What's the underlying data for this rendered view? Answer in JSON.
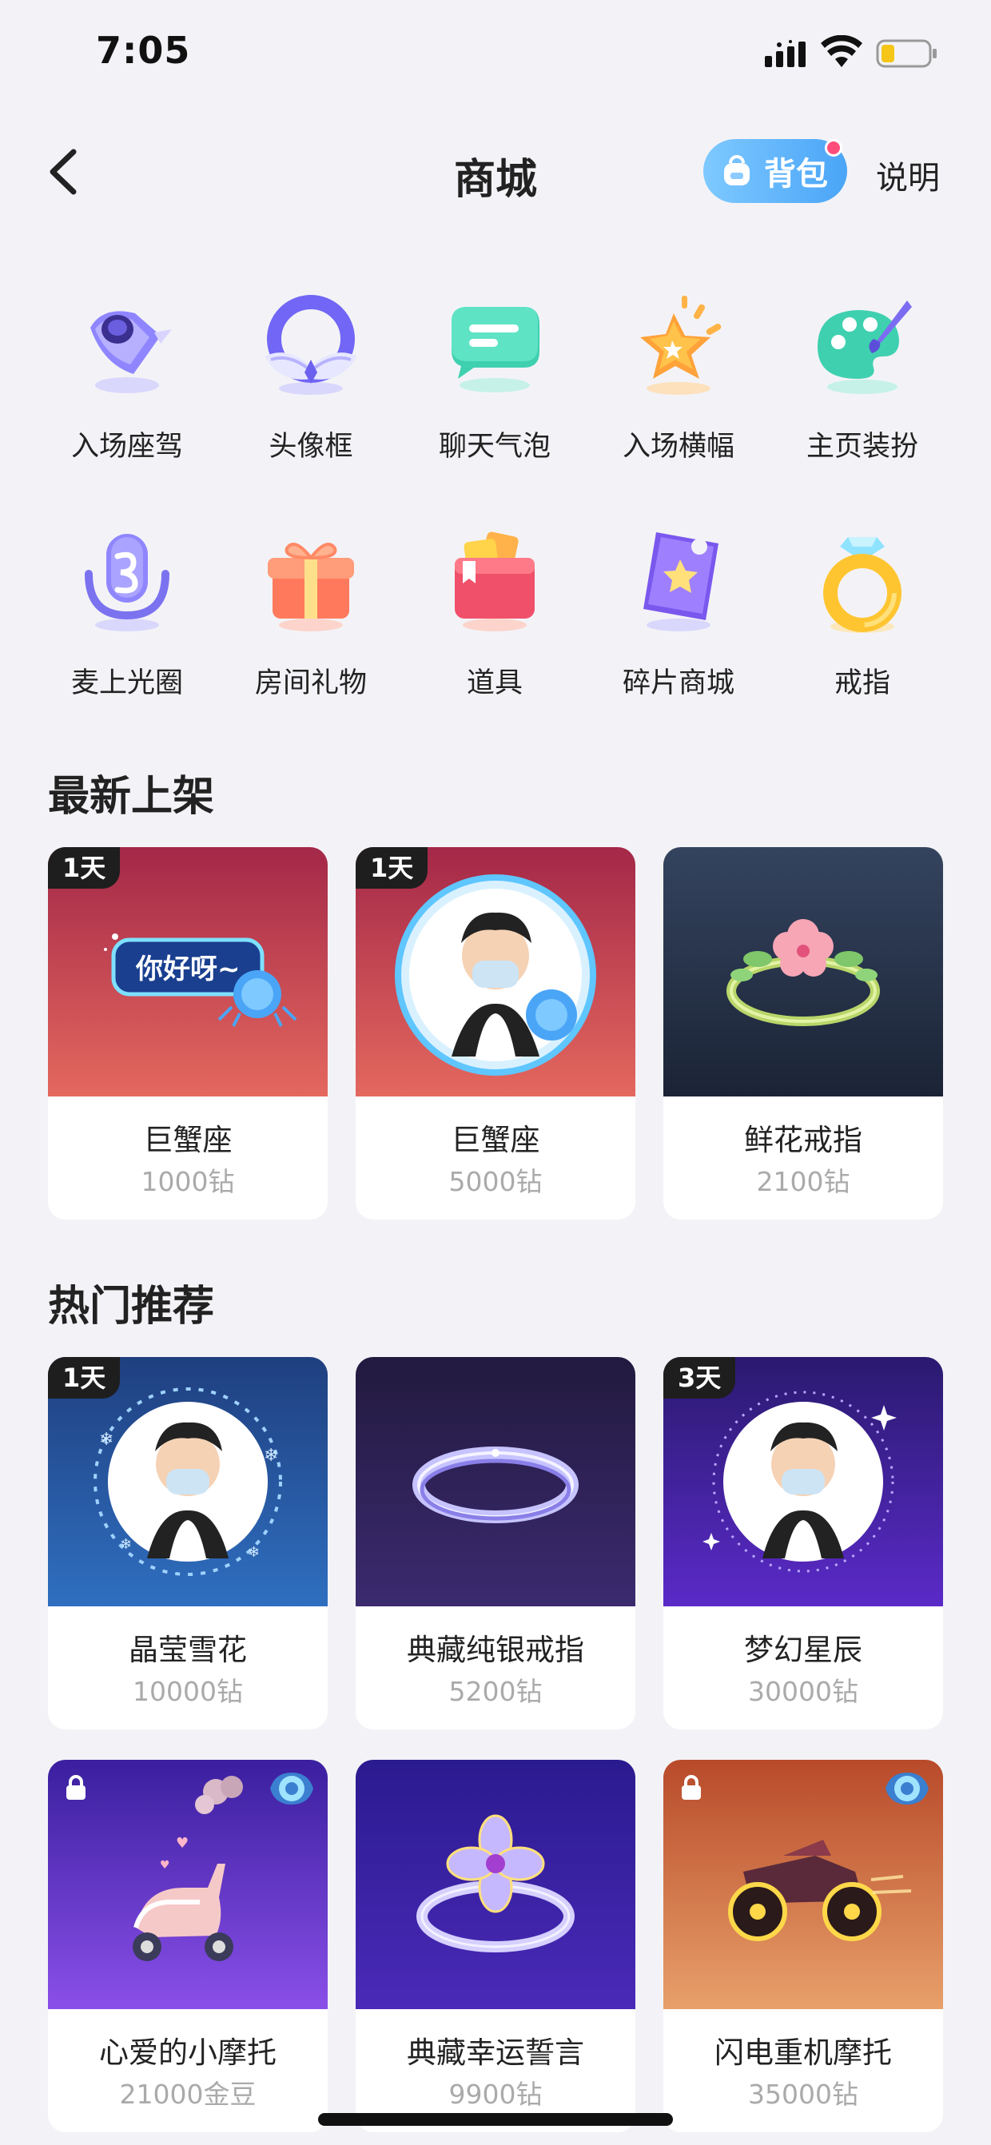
{
  "status_bar": {
    "time": "7:05"
  },
  "nav": {
    "title": "商城",
    "bag_label": "背包",
    "help_label": "说明"
  },
  "categories": [
    {
      "label": "入场座驾",
      "icon": "rocket-icon"
    },
    {
      "label": "头像框",
      "icon": "avatar-frame-icon"
    },
    {
      "label": "聊天气泡",
      "icon": "chat-bubble-icon"
    },
    {
      "label": "入场横幅",
      "icon": "star-banner-icon"
    },
    {
      "label": "主页装扮",
      "icon": "palette-icon"
    },
    {
      "label": "麦上光圈",
      "icon": "microphone-icon"
    },
    {
      "label": "房间礼物",
      "icon": "gift-icon"
    },
    {
      "label": "道具",
      "icon": "wallet-icon"
    },
    {
      "label": "碎片商城",
      "icon": "fragment-ticket-icon"
    },
    {
      "label": "戒指",
      "icon": "ring-icon"
    }
  ],
  "sections": {
    "latest": {
      "title": "最新上架",
      "items": [
        {
          "name": "巨蟹座",
          "price": "1000钻",
          "tag": "1天",
          "bubble_text": "你好呀~",
          "image": "crab-chat-bubble"
        },
        {
          "name": "巨蟹座",
          "price": "5000钻",
          "tag": "1天",
          "image": "crab-avatar-frame"
        },
        {
          "name": "鲜花戒指",
          "price": "2100钻",
          "tag": "",
          "image": "flower-ring"
        }
      ]
    },
    "hot": {
      "title": "热门推荐",
      "items": [
        {
          "name": "晶莹雪花",
          "price": "10000钻",
          "tag": "1天",
          "image": "snowflake-avatar-frame"
        },
        {
          "name": "典藏纯银戒指",
          "price": "5200钻",
          "tag": "",
          "image": "silver-ring"
        },
        {
          "name": "梦幻星辰",
          "price": "30000钻",
          "tag": "3天",
          "image": "starry-avatar-frame"
        },
        {
          "name": "心爱的小摩托",
          "price": "21000金豆",
          "tag": "",
          "locked": true,
          "badge": true,
          "image": "scooter"
        },
        {
          "name": "典藏幸运誓言",
          "price": "9900钻",
          "tag": "",
          "image": "clover-ring"
        },
        {
          "name": "闪电重机摩托",
          "price": "35000钻",
          "tag": "",
          "locked": true,
          "badge": true,
          "image": "motorbike"
        }
      ]
    }
  },
  "colors": {
    "bag_gradient_start": "#7ec9ff",
    "bag_gradient_end": "#4aa5f7",
    "notification_dot": "#ff4d7a"
  }
}
